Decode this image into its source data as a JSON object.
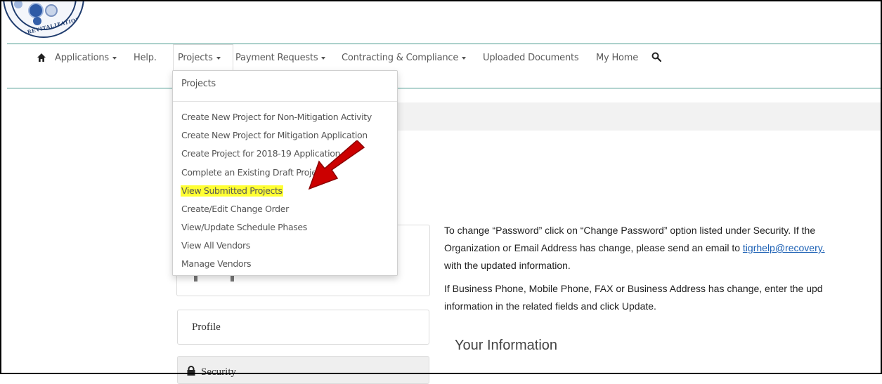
{
  "logo": {
    "text": "REVITALIZATION"
  },
  "nav": {
    "home_icon": "home-icon",
    "items": [
      "Applications",
      "Help.",
      "Projects",
      "Payment Requests",
      "Contracting & Compliance",
      "Uploaded Documents",
      "My Home"
    ],
    "search_icon": "search-icon"
  },
  "dropdown": {
    "header": "Projects",
    "items": [
      "Create New Project for Non-Mitigation Activity",
      "Create New Project for Mitigation Application",
      "Create Project for 2018-19 Application",
      "Complete an Existing Draft Project",
      "View Submitted Projects",
      "Create/Edit Change Order",
      "View/Update Schedule Phases",
      "View All Vendors",
      "Manage Vendors"
    ],
    "highlighted_item": "View Submitted Projects",
    "highlight_color": "#ffff33"
  },
  "annotation": {
    "arrow_color": "#cc0000"
  },
  "sidebar": {
    "profile_label": "Profile",
    "security_label": "Security"
  },
  "content": {
    "para1_line1": "To change “Password” click on “Change Password” option listed under Security. If the",
    "para1_line2_before": "Organization or Email Address has change, please send an email to ",
    "para1_link": "tigrhelp@recovery.",
    "para1_line3": "with the updated information.",
    "para2_line1": "If Business Phone, Mobile Phone, FAX or Business Address has change, enter the upd",
    "para2_line2": "information in the related fields and click Update.",
    "heading": "Your Information"
  },
  "colors": {
    "nav_border": "#4c9b91",
    "link": "#1a5fb4"
  }
}
